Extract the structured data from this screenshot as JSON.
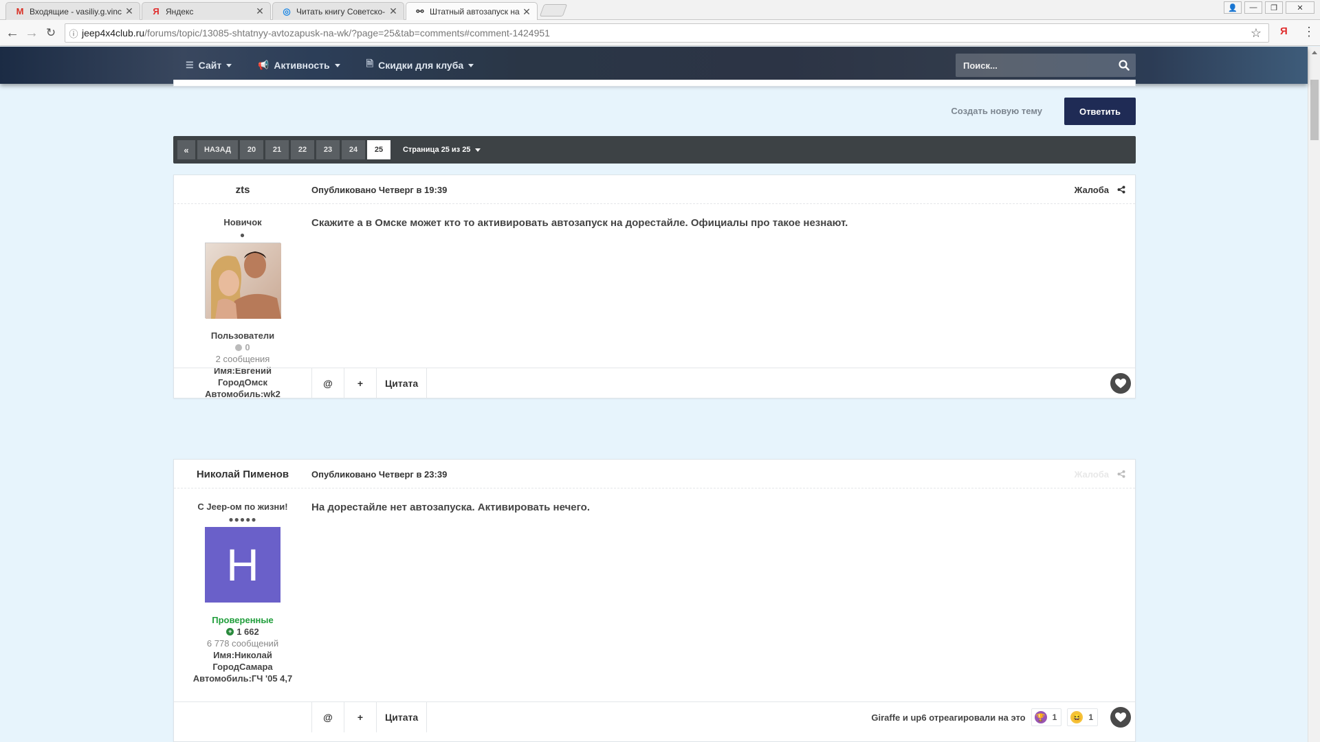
{
  "browser": {
    "tabs": [
      {
        "icon": "M",
        "title": "Входящие - vasiliy.g.vinc",
        "active": false
      },
      {
        "icon": "Я",
        "title": "Яндекс",
        "active": false
      },
      {
        "icon": "◎",
        "title": "Читать книгу Советско-",
        "active": false
      },
      {
        "icon": "⚯",
        "title": "Штатный автозапуск на",
        "active": true
      }
    ],
    "url_host": "jeep4x4club.ru",
    "url_path": "/forums/topic/13085-shtatnyy-avtozapusk-na-wk/?page=25&tab=comments#comment-1424951",
    "ext_label": "Я"
  },
  "nav": {
    "items": [
      {
        "icon": "☰",
        "label": "Сайт"
      },
      {
        "icon": "📢",
        "label": "Активность"
      },
      {
        "icon": "🗎",
        "label": "Скидки для клуба"
      }
    ],
    "search_placeholder": "Поиск..."
  },
  "actions": {
    "new_topic": "Создать новую тему",
    "reply": "Ответить"
  },
  "pagination": {
    "first": "«",
    "prev": "НАЗАД",
    "pages": [
      "20",
      "21",
      "22",
      "23",
      "24",
      "25"
    ],
    "current": "25",
    "label": "Страница 25 из 25"
  },
  "posts": [
    {
      "author": "zts",
      "date": "Опубликовано Четверг в 19:39",
      "report": "Жалоба",
      "rank": "Новичок",
      "pips": "●",
      "avatar_type": "photo",
      "group": "Пользователи",
      "reputation": "0",
      "posts_count": "2 сообщения",
      "fields": [
        "Имя:Евгений",
        "ГородОмск",
        "Автомобиль:wk2"
      ],
      "body": "Скажите а в Омске может кто то активировать автозапуск на дорестайле. Официалы про такое незнают.",
      "buttons": [
        "@",
        "+",
        "Цитата"
      ],
      "reactions_text": ""
    },
    {
      "author": "Николай Пименов",
      "date": "Опубликовано Четверг в 23:39",
      "report": "Жалоба",
      "rank": "С Jeep-ом по жизни!",
      "pips": "●●●●●",
      "avatar_type": "letter",
      "avatar_letter": "Н",
      "group": "Проверенные",
      "reputation": "1 662",
      "posts_count": "6 778 сообщений",
      "fields": [
        "Имя:Николай",
        "ГородСамара",
        "Автомобиль:ГЧ '05 4,7"
      ],
      "body": "На дорестайле нет автозапуска. Активировать нечего.",
      "buttons": [
        "@",
        "+",
        "Цитата"
      ],
      "reactions_text": "Giraffe и up6 отреагировали на это",
      "reactions": [
        {
          "icon": "trophy-icon",
          "count": "1"
        },
        {
          "icon": "laugh-icon",
          "count": "1"
        }
      ]
    }
  ]
}
